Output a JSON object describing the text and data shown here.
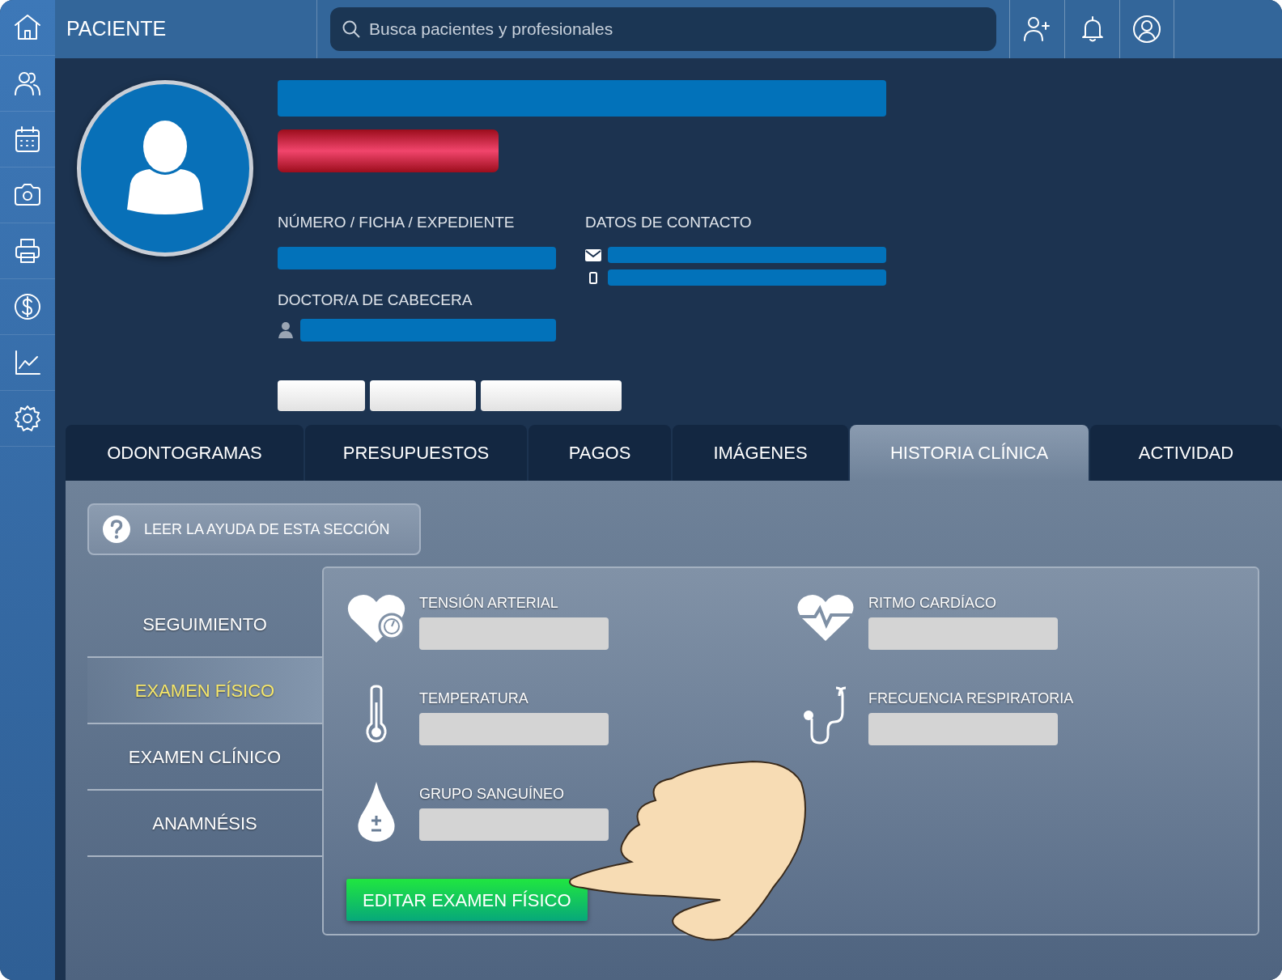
{
  "header": {
    "title": "PACIENTE",
    "search": {
      "placeholder": "Busca pacientes y profesionales"
    }
  },
  "profile": {
    "number_label": "NÚMERO / FICHA / EXPEDIENTE",
    "contact_label": "DATOS DE CONTACTO",
    "doctor_label": "DOCTOR/A DE CABECERA"
  },
  "tabs": [
    {
      "label": "ODONTOGRAMAS",
      "selected": false
    },
    {
      "label": "PRESUPUESTOS",
      "selected": false
    },
    {
      "label": "PAGOS",
      "selected": false
    },
    {
      "label": "IMÁGENES",
      "selected": false
    },
    {
      "label": "HISTORIA CLÍNICA",
      "selected": true
    },
    {
      "label": "ACTIVIDAD",
      "selected": false
    }
  ],
  "help_button": "LEER LA AYUDA DE ESTA SECCIÓN",
  "subnav": [
    {
      "label": "SEGUIMIENTO",
      "selected": false
    },
    {
      "label": "EXAMEN FÍSICO",
      "selected": true
    },
    {
      "label": "EXAMEN CLÍNICO",
      "selected": false
    },
    {
      "label": "ANAMNÉSIS",
      "selected": false
    }
  ],
  "vitals": [
    {
      "kind": "blood-pressure",
      "label": "TENSIÓN ARTERIAL"
    },
    {
      "kind": "heart-rate",
      "label": "RITMO CARDÍACO"
    },
    {
      "kind": "temperature",
      "label": "TEMPERATURA"
    },
    {
      "kind": "respiratory",
      "label": "FRECUENCIA RESPIRATORIA"
    },
    {
      "kind": "blood-type",
      "label": "GRUPO SANGUÍNEO"
    }
  ],
  "edit_button": "EDITAR EXAMEN FÍSICO"
}
